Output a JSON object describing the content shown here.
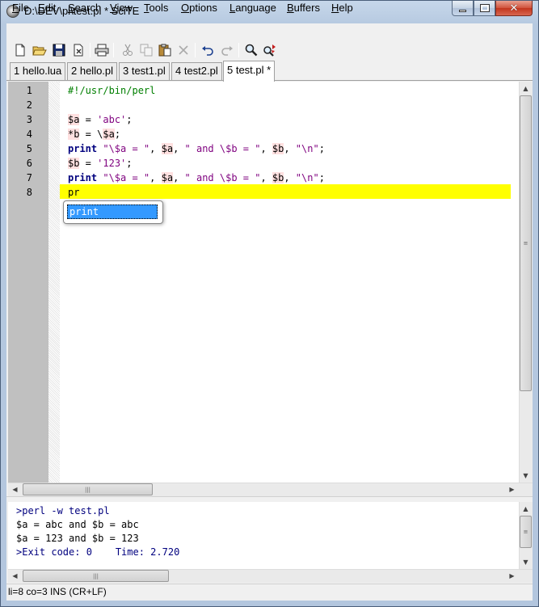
{
  "window": {
    "title": "D:\\DEV\\pl\\test.pl * SciTE",
    "icon": "scite-app-icon"
  },
  "menu": [
    "File",
    "Edit",
    "Search",
    "View",
    "Tools",
    "Options",
    "Language",
    "Buffers",
    "Help"
  ],
  "toolbar": [
    "new-file-icon",
    "open-folder-icon",
    "save-icon",
    "close-file-icon",
    "print-icon",
    "cut-icon",
    "copy-icon",
    "paste-icon",
    "delete-icon",
    "undo-icon",
    "redo-icon",
    "find-icon",
    "replace-icon"
  ],
  "tabs": [
    {
      "label": "1 hello.lua",
      "active": false
    },
    {
      "label": "2 hello.pl",
      "active": false
    },
    {
      "label": "3 test1.pl",
      "active": false
    },
    {
      "label": "4 test2.pl",
      "active": false
    },
    {
      "label": "5 test.pl *",
      "active": true
    }
  ],
  "editor": {
    "line_numbers": [
      "1",
      "2",
      "3",
      "4",
      "5",
      "6",
      "7",
      "8"
    ],
    "lines": [
      "#!/usr/bin/perl",
      "",
      "$a = 'abc';",
      "*b = \\$a;",
      "print \"\\$a = \", $a, \" and \\$b = \", $b, \"\\n\";",
      "$b = '123';",
      "print \"\\$a = \", $a, \" and \\$b = \", $b, \"\\n\";",
      "pr"
    ],
    "caret_line": 8,
    "autocomplete": [
      "print"
    ]
  },
  "output": {
    "lines": [
      ">perl -w test.pl",
      "$a = abc and $b = abc",
      "$a = 123 and $b = 123",
      ">Exit code: 0    Time: 2.720"
    ]
  },
  "status": "li=8 co=3 INS (CR+LF)",
  "colors": {
    "caret_line": "#ffff00",
    "comment": "#007f00",
    "keyword": "#00007f",
    "string": "#7f007f",
    "variable_bg": "#ffe0e0",
    "autocomplete_selected": "#3399ff"
  }
}
